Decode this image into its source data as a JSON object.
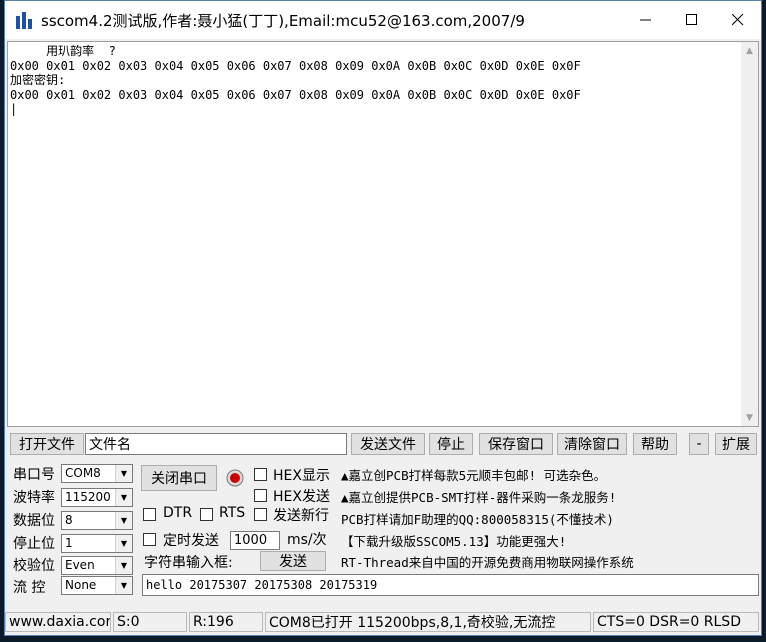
{
  "window": {
    "title": "sscom4.2测试版,作者:聂小猛(丁丁),Email:mcu52@163.com,2007/9"
  },
  "receive": {
    "lines": [
      "     用玐韵率  ?",
      "0x00 0x01 0x02 0x03 0x04 0x05 0x06 0x07 0x08 0x09 0x0A 0x0B 0x0C 0x0D 0x0E 0x0F",
      "加密密钥:",
      "0x00 0x01 0x02 0x03 0x04 0x05 0x06 0x07 0x08 0x09 0x0A 0x0B 0x0C 0x0D 0x0E 0x0F",
      "|"
    ]
  },
  "filebar": {
    "open_file": "打开文件",
    "filename": "文件名",
    "send_file": "发送文件",
    "stop": "停止",
    "save_window": "保存窗口",
    "clear_window": "清除窗口",
    "help": "帮助",
    "minus": "-",
    "expand": "扩展"
  },
  "port": {
    "com_label": "串口号",
    "com_value": "COM8",
    "baud_label": "波特率",
    "baud_value": "115200",
    "data_label": "数据位",
    "data_value": "8",
    "stop_label": "停止位",
    "stop_value": "1",
    "parity_label": "校验位",
    "parity_value": "Even",
    "flow_label": "流 控",
    "flow_value": "None"
  },
  "controls": {
    "close_port": "关闭串口",
    "hex_display": "HEX显示",
    "hex_send": "HEX发送",
    "dtr": "DTR",
    "rts": "RTS",
    "send_newline": "发送新行",
    "timed_send": "定时发送",
    "interval": "1000",
    "interval_unit": "ms/次",
    "input_label": "字符串输入框:",
    "send": "发送",
    "send_text": "hello 20175307 20175308 20175319"
  },
  "info_lines": [
    "▲嘉立创PCB打样每款5元顺丰包邮! 可选杂色。",
    "▲嘉立创提供PCB-SMT打样-器件采购一条龙服务!",
    "PCB打样请加F助理的QQ:800058315(不懂技术)",
    "【下载升级版SSCOM5.13】功能更强大!",
    "RT-Thread来自中国的开源免费商用物联网操作系统"
  ],
  "status": {
    "site": "www.daxia.cor",
    "sent": "S:0",
    "received": "R:196",
    "port_state": "COM8已打开  115200bps,8,1,奇校验,无流控",
    "lines": "CTS=0 DSR=0 RLSD"
  },
  "colors": {
    "record_led": "#cc0000"
  }
}
